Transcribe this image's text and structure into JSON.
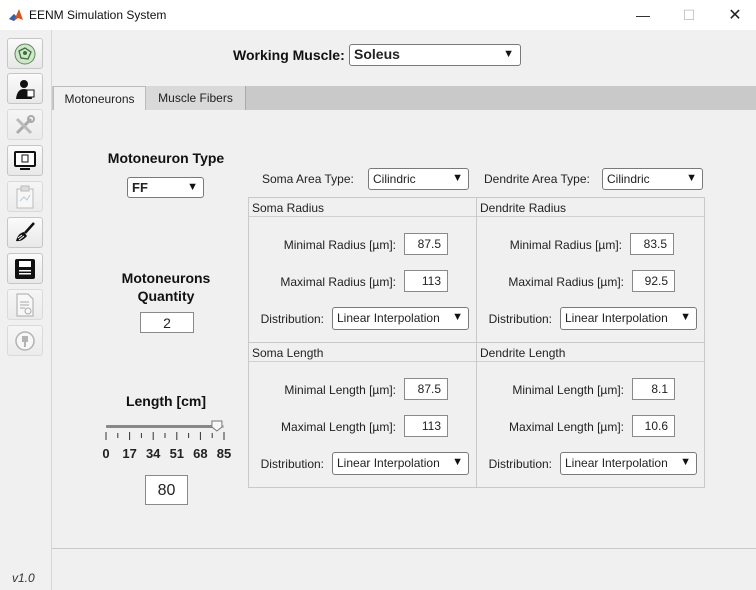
{
  "window": {
    "title": "EENM Simulation System",
    "minimize": "—",
    "maximize": "☐",
    "close": "✕"
  },
  "sidebar": {
    "version": "v1.0"
  },
  "header": {
    "muscle_label": "Working Muscle:",
    "muscle_value": "Soleus"
  },
  "tabs": [
    {
      "label": "Motoneurons"
    },
    {
      "label": "Muscle Fibers"
    }
  ],
  "left": {
    "type_label": "Motoneuron Type",
    "type_value": "FF",
    "quantity_label_1": "Motoneurons",
    "quantity_label_2": "Quantity",
    "quantity_value": "2",
    "length_label": "Length [cm]",
    "slider_ticks": [
      "0",
      "17",
      "34",
      "51",
      "68",
      "85"
    ],
    "slider_level": 0.94,
    "length_value": "80"
  },
  "area_types": {
    "soma_label": "Soma Area Type:",
    "soma_value": "Cilindric",
    "dendrite_label": "Dendrite Area Type:",
    "dendrite_value": "Cilindric"
  },
  "panels": {
    "soma_radius": {
      "title": "Soma Radius",
      "min_label": "Minimal Radius [µm]:",
      "min_value": "87.5",
      "max_label": "Maximal Radius [µm]:",
      "max_value": "113",
      "dist_label": "Distribution:",
      "dist_value": "Linear Interpolation"
    },
    "dendrite_radius": {
      "title": "Dendrite Radius",
      "min_label": "Minimal Radius [µm]:",
      "min_value": "83.5",
      "max_label": "Maximal Radius [µm]:",
      "max_value": "92.5",
      "dist_label": "Distribution:",
      "dist_value": "Linear Interpolation"
    },
    "soma_length": {
      "title": "Soma Length",
      "min_label": "Minimal Length [µm]:",
      "min_value": "87.5",
      "max_label": "Maximal Length [µm]:",
      "max_value": "113",
      "dist_label": "Distribution:",
      "dist_value": "Linear Interpolation"
    },
    "dendrite_length": {
      "title": "Dendrite Length",
      "min_label": "Minimal Length [µm]:",
      "min_value": "8.1",
      "max_label": "Maximal Length [µm]:",
      "max_value": "10.6",
      "dist_label": "Distribution:",
      "dist_value": "Linear Interpolation"
    }
  },
  "icons": [
    "network-icon",
    "user-icon",
    "tools-icon",
    "monitor-icon",
    "clipboard-icon",
    "broom-icon",
    "save-icon",
    "document-icon",
    "power-icon"
  ],
  "colors": {
    "tab_bar": "#c9c9c9",
    "app_icon": "#d9531e"
  }
}
